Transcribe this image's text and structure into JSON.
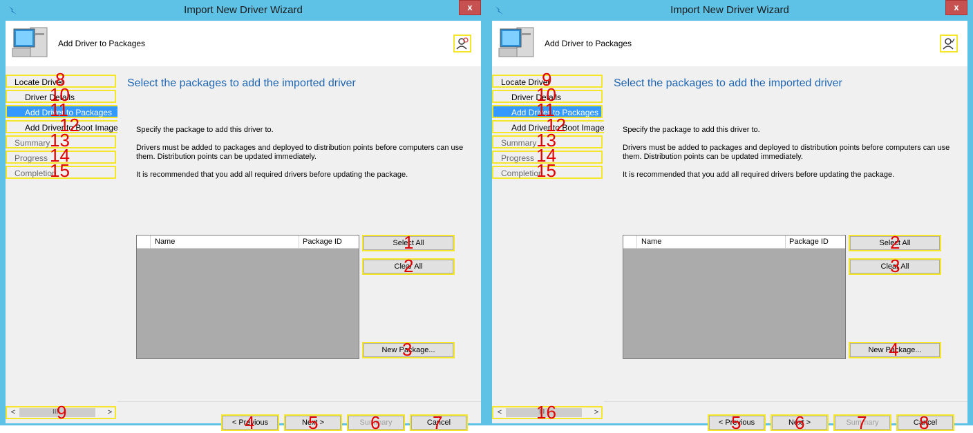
{
  "window": {
    "title": "Import New Driver Wizard",
    "close_label": "x"
  },
  "header": {
    "title": "Add Driver to Packages"
  },
  "sidebar": {
    "items": [
      {
        "label": "Locate Driver"
      },
      {
        "label": "Driver Details"
      },
      {
        "label": "Add Driver to Packages"
      },
      {
        "label": "Add Driver to Boot Image"
      },
      {
        "label": "Summary"
      },
      {
        "label": "Progress"
      },
      {
        "label": "Completion"
      }
    ],
    "scroll_left": "<",
    "scroll_right": ">",
    "scroll_grip": "III"
  },
  "main": {
    "title": "Select the packages to add the imported driver",
    "p1": "Specify the package to add this driver to.",
    "p2": "Drivers must be added to packages and deployed to distribution points before computers can use them.  Distribution points can be updated immediately.",
    "p3": "It is recommended that you add all required drivers before updating the package.",
    "columns": {
      "name": "Name",
      "package_id": "Package ID"
    },
    "select_all": "Select All",
    "clear_all": "Clear All",
    "new_package": "New Package..."
  },
  "footer": {
    "previous": "< Previous",
    "next": "Next >",
    "summary": "Summary",
    "cancel": "Cancel"
  },
  "badges_left": {
    "select_all": "1",
    "clear_all": "2",
    "new_package": "3",
    "previous": "4",
    "next": "5",
    "summary": "6",
    "cancel": "7",
    "locate": "8",
    "scroll": "9",
    "details": "10",
    "add_pkg": "11",
    "boot": "12",
    "summary_nav": "13",
    "progress": "14",
    "completion": "15"
  },
  "badges_right": {
    "select_all": "2",
    "clear_all": "3",
    "new_package": "4",
    "previous": "5",
    "next": "6",
    "summary": "7",
    "cancel": "8",
    "locate": "9",
    "details": "10",
    "add_pkg": "11",
    "boot": "12",
    "summary_nav": "13",
    "progress": "14",
    "completion": "15",
    "scroll": "16"
  },
  "colors": {
    "title_bar": "#5ec1e6",
    "highlight": "#f5e62a",
    "active_nav": "#3399ff",
    "heading": "#1e66b4",
    "badge": "#e00000"
  }
}
